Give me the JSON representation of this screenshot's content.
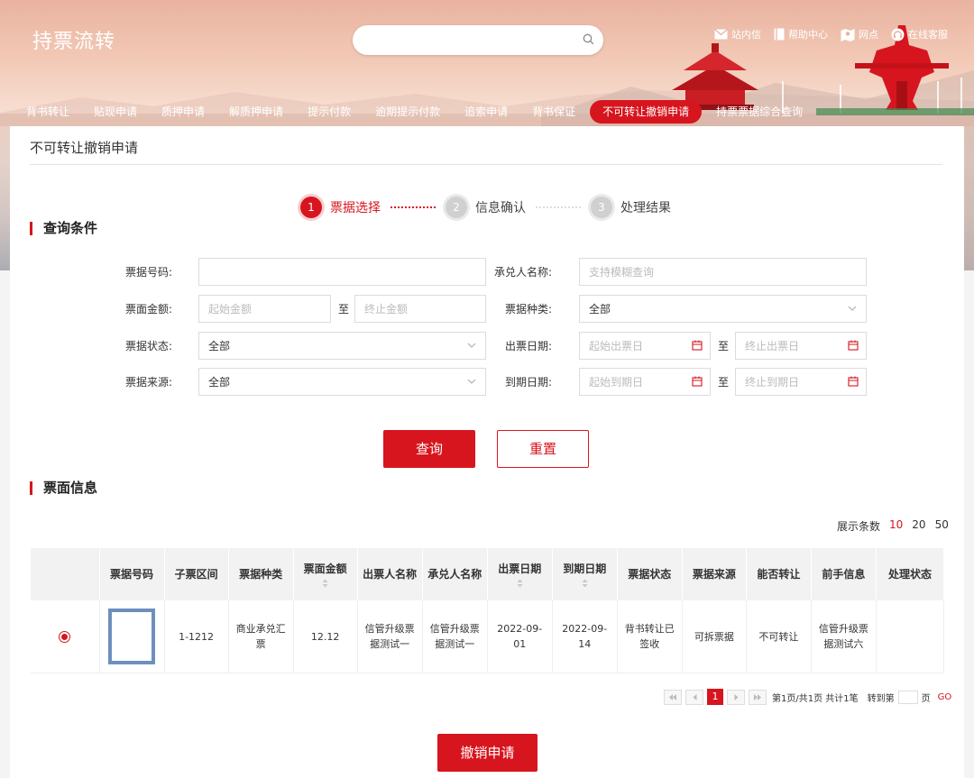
{
  "header": {
    "app_title": "持票流转",
    "search": {
      "placeholder": "",
      "value": ""
    },
    "links": [
      {
        "label": "站内信",
        "icon": "mail-icon"
      },
      {
        "label": "帮助中心",
        "icon": "book-icon"
      },
      {
        "label": "网点",
        "icon": "map-icon"
      },
      {
        "label": "在线客服",
        "icon": "headset-icon"
      }
    ]
  },
  "nav": {
    "items": [
      "背书转让",
      "贴现申请",
      "质押申请",
      "解质押申请",
      "提示付款",
      "逾期提示付款",
      "追索申请",
      "背书保证",
      "不可转让撤销申请",
      "持票票据综合查询"
    ],
    "active_index": 8
  },
  "page": {
    "title": "不可转让撤销申请"
  },
  "steps": [
    {
      "num": "1",
      "label": "票据选择"
    },
    {
      "num": "2",
      "label": "信息确认"
    },
    {
      "num": "3",
      "label": "处理结果"
    }
  ],
  "query": {
    "section_title": "查询条件",
    "bill_no_label": "票据号码:",
    "bill_no_value": "",
    "acceptor_label": "承兑人名称:",
    "acceptor_placeholder": "支持模糊查询",
    "amount_label": "票面金额:",
    "amount_start_placeholder": "起始金额",
    "amount_end_placeholder": "终止金额",
    "to": "至",
    "bill_type_label": "票据种类:",
    "bill_type_value": "全部",
    "bill_status_label": "票据状态:",
    "bill_status_value": "全部",
    "issue_date_label": "出票日期:",
    "issue_start_placeholder": "起始出票日",
    "issue_end_placeholder": "终止出票日",
    "bill_source_label": "票据来源:",
    "bill_source_value": "全部",
    "due_date_label": "到期日期:",
    "due_start_placeholder": "起始到期日",
    "due_end_placeholder": "终止到期日",
    "search_button": "查询",
    "reset_button": "重置"
  },
  "results": {
    "section_title": "票面信息",
    "page_size_label": "展示条数",
    "page_sizes": [
      "10",
      "20",
      "50"
    ],
    "page_size_selected": "10",
    "columns": [
      "",
      "票据号码",
      "子票区间",
      "票据种类",
      "票面金额",
      "出票人名称",
      "承兑人名称",
      "出票日期",
      "到期日期",
      "票据状态",
      "票据来源",
      "能否转让",
      "前手信息",
      "处理状态"
    ],
    "rows": [
      {
        "selected": true,
        "bill_no": "",
        "sub_range": "1-1212",
        "bill_type": "商业承兑汇票",
        "amount": "12.12",
        "drawer": "信管升级票据测试一",
        "acceptor": "信管升级票据测试一",
        "issue_date": "2022-09-01",
        "due_date": "2022-09-14",
        "status": "背书转让已签收",
        "source": "可拆票据",
        "transferable": "不可转让",
        "prior_holder": "信管升级票据测试六",
        "process_status": ""
      }
    ],
    "pager": {
      "current_page": "1",
      "summary": "第1页/共1页 共计1笔",
      "goto_label": "转到第",
      "page_unit": "页",
      "go": "GO"
    }
  },
  "footer": {
    "revoke_button": "撤销申请"
  },
  "colors": {
    "accent": "#d7151e",
    "thumb_border": "#6e8fbd"
  }
}
